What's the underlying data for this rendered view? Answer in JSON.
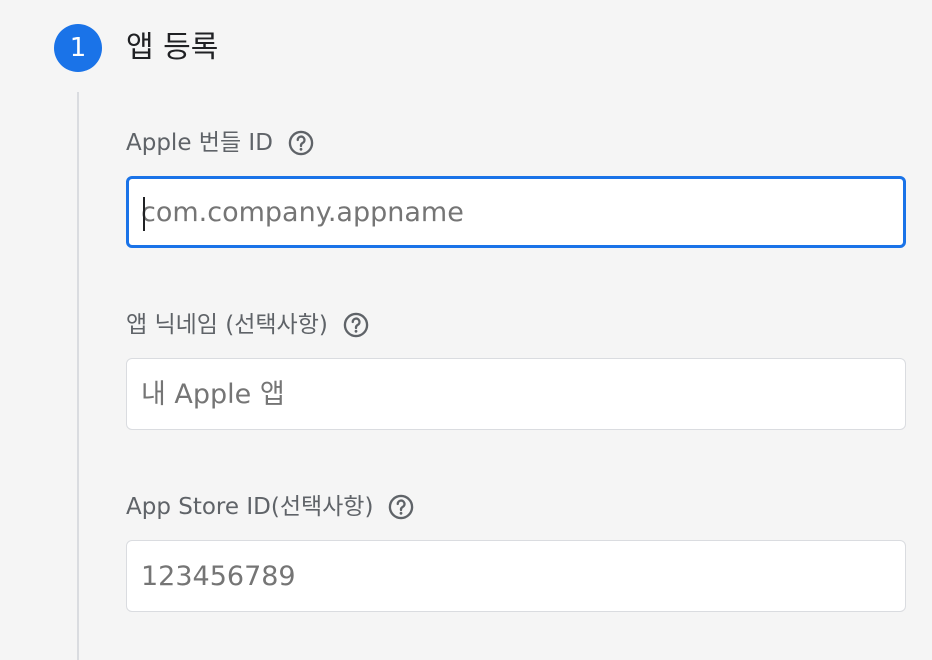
{
  "step": {
    "number": "1",
    "title": "앱 등록"
  },
  "fields": {
    "bundle_id": {
      "label": "Apple 번들 ID",
      "placeholder": "com.company.appname",
      "value": ""
    },
    "nickname": {
      "label": "앱 닉네임 (선택사항)",
      "placeholder": "내 Apple 앱",
      "value": ""
    },
    "app_store_id": {
      "label": "App Store ID(선택사항)",
      "placeholder": "123456789",
      "value": ""
    }
  },
  "icons": {
    "help": "help-circle-icon"
  },
  "colors": {
    "accent": "#1a73e8",
    "label": "#5f6368",
    "border": "#dadce0"
  }
}
